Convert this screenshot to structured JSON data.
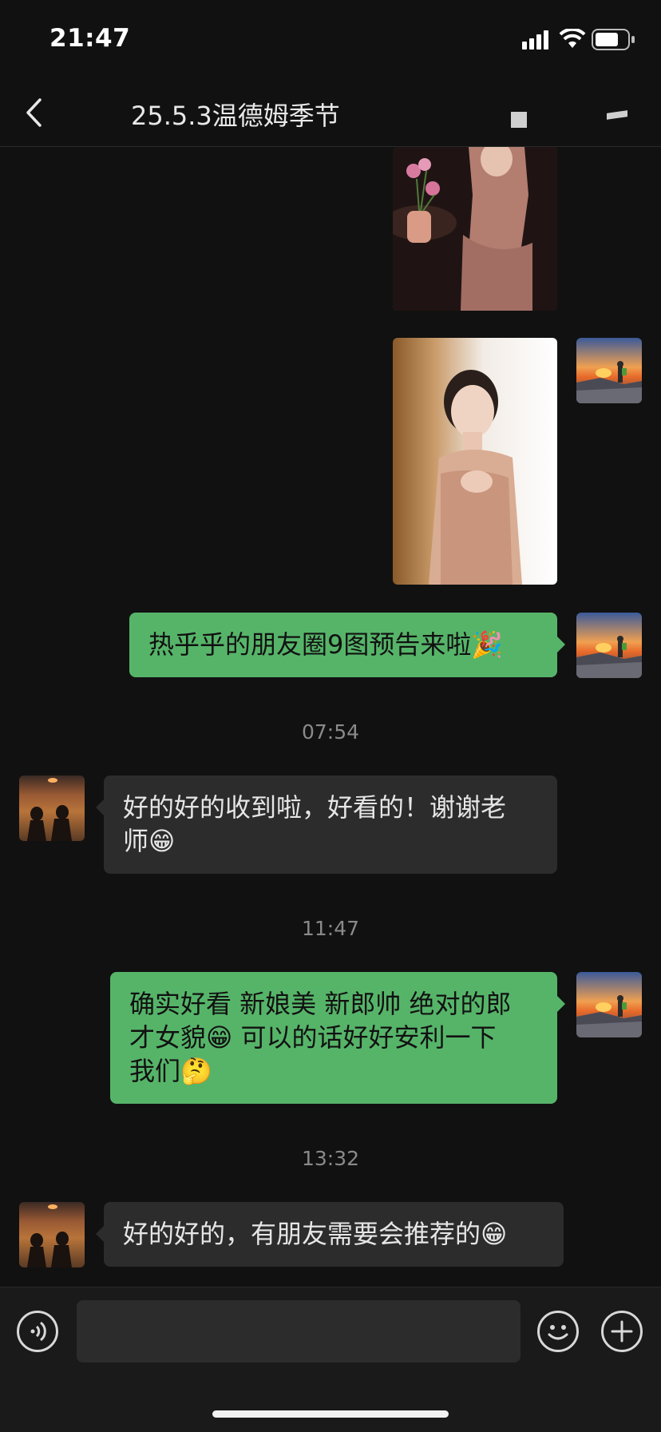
{
  "status_bar": {
    "time": "21:47"
  },
  "header": {
    "title": "25.5.3温德姆季节"
  },
  "messages": [
    {
      "type": "image",
      "direction": "out"
    },
    {
      "type": "image",
      "direction": "out"
    },
    {
      "type": "text",
      "direction": "out",
      "text": "热乎乎的朋友圈9图预告来啦🎉"
    },
    {
      "type": "timestamp",
      "text": "07:54"
    },
    {
      "type": "text",
      "direction": "in",
      "lines": [
        "好的好的收到啦，好看的！谢谢老",
        "师😁"
      ]
    },
    {
      "type": "timestamp",
      "text": "11:47"
    },
    {
      "type": "text",
      "direction": "out",
      "lines": [
        "确实好看 新娘美 新郎帅 绝对的郎",
        "才女貌😁 可以的话好好安利一下",
        "我们🤔"
      ]
    },
    {
      "type": "timestamp",
      "text": "13:32"
    },
    {
      "type": "text",
      "direction": "in",
      "text": "好的好的，有朋友需要会推荐的😁"
    }
  ],
  "colors": {
    "outgoing_bubble": "#56b469",
    "incoming_bubble": "#2c2c2c",
    "background": "#111111"
  },
  "icons": [
    "back-chevron-icon",
    "signal-icon",
    "wifi-icon",
    "battery-icon",
    "voice-icon",
    "emoji-icon",
    "plus-icon"
  ]
}
